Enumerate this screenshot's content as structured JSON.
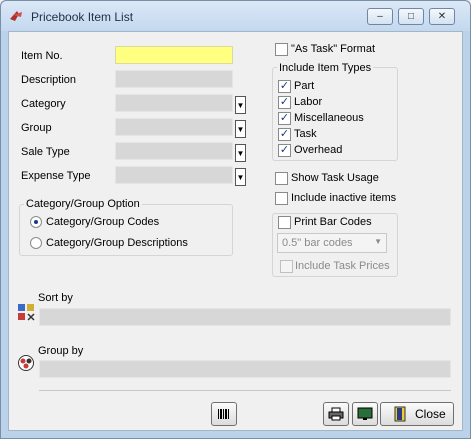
{
  "window": {
    "title": "Pricebook Item List",
    "controls": [
      "minimize",
      "maximize",
      "close"
    ]
  },
  "form": {
    "item_no_label": "Item No.",
    "description_label": "Description",
    "category_label": "Category",
    "group_label": "Group",
    "sale_type_label": "Sale Type",
    "expense_type_label": "Expense Type"
  },
  "cat_group_option": {
    "title": "Category/Group Option",
    "codes_label": "Category/Group Codes",
    "descriptions_label": "Category/Group Descriptions",
    "selected": "codes"
  },
  "as_task": {
    "label": "\"As Task\" Format",
    "checked": false
  },
  "item_types": {
    "title": "Include Item Types",
    "items": [
      {
        "label": "Part",
        "checked": true
      },
      {
        "label": "Labor",
        "checked": true
      },
      {
        "label": "Miscellaneous",
        "checked": true
      },
      {
        "label": "Task",
        "checked": true
      },
      {
        "label": "Overhead",
        "checked": true
      }
    ]
  },
  "show_task_usage": {
    "label": "Show Task Usage",
    "checked": false
  },
  "include_inactive": {
    "label": "Include inactive items",
    "checked": false
  },
  "barcodes": {
    "print_label": "Print Bar Codes",
    "size_value": "0.5\" bar codes",
    "include_task_prices_label": "Include Task Prices"
  },
  "sort_by_label": "Sort by",
  "group_by_label": "Group by",
  "footer": {
    "close_label": "Close"
  },
  "colors": {
    "accent_field": "#ffff80",
    "check_mark": "#1a3a8a"
  }
}
